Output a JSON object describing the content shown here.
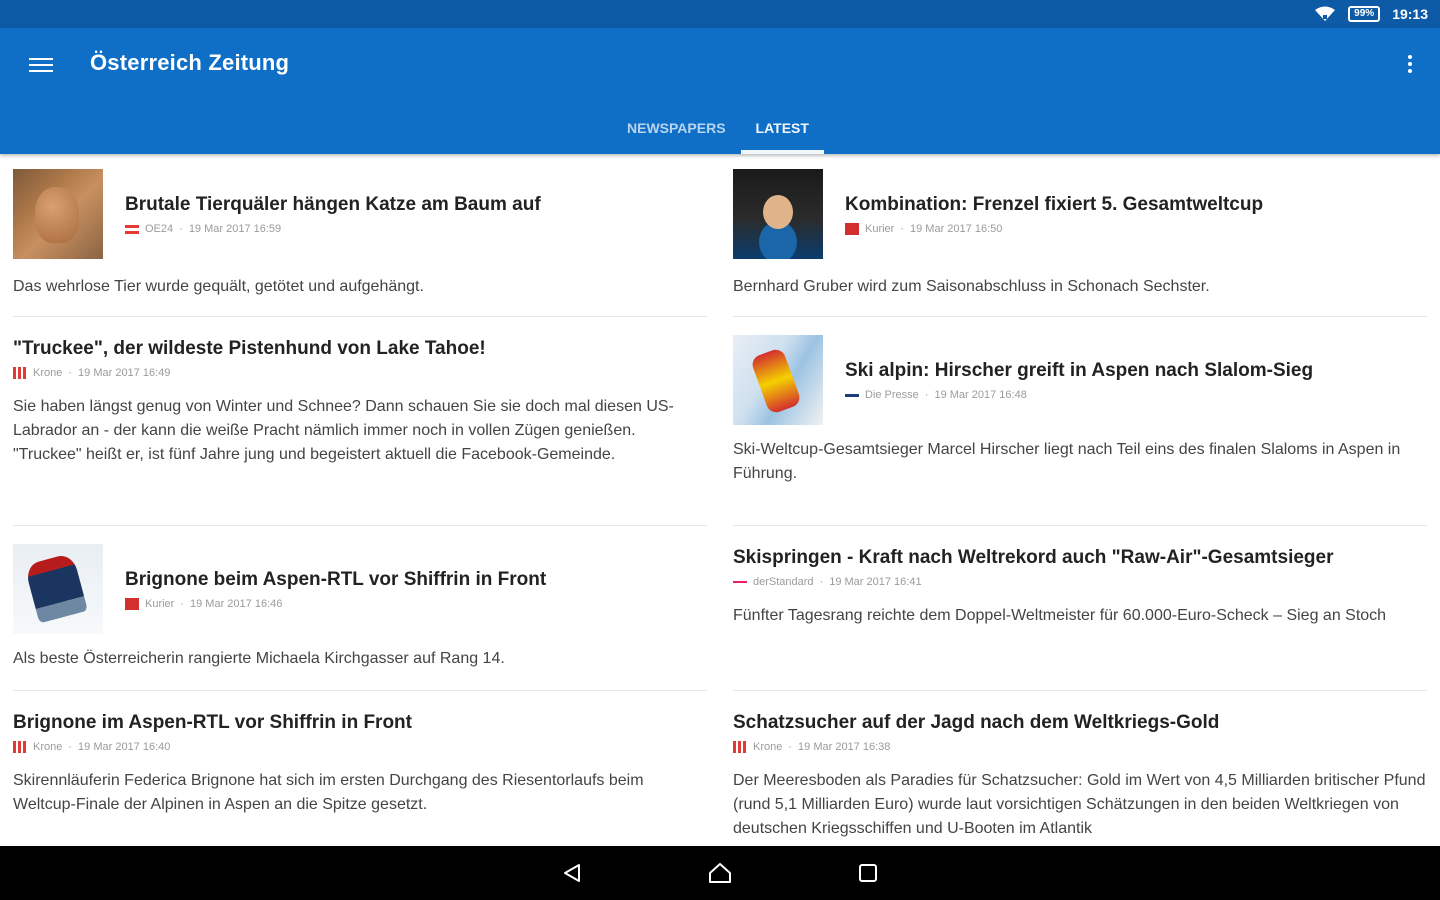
{
  "status_bar": {
    "battery": "99%",
    "time": "19:13"
  },
  "app_bar": {
    "title": "Österreich Zeitung"
  },
  "tabs": [
    {
      "label": "NEWSPAPERS",
      "active": false
    },
    {
      "label": "LATEST",
      "active": true
    }
  ],
  "articles_left": [
    {
      "title": "Brutale Tierquäler hängen Katze am Baum auf",
      "source": "OE24",
      "date": "19 Mar 2017 16:59",
      "summary": "Das wehrlose Tier wurde gequält, getötet und aufgehängt."
    },
    {
      "title": "\"Truckee\", der wildeste Pistenhund von Lake Tahoe!",
      "source": "Krone",
      "date": "19 Mar 2017 16:49",
      "summary": "Sie haben längst genug von Winter und Schnee? Dann schauen Sie sie doch mal diesen US-Labrador an - der kann die weiße Pracht nämlich immer noch in vollen Zügen genießen. \"Truckee\" heißt er, ist fünf Jahre jung und begeistert aktuell die Facebook-Gemeinde."
    },
    {
      "title": "Brignone beim Aspen-RTL vor Shiffrin in Front",
      "source": "Kurier",
      "date": "19 Mar 2017 16:46",
      "summary": "Als beste Österreicherin rangierte Michaela Kirchgasser auf Rang 14."
    },
    {
      "title": "Brignone im Aspen-RTL vor Shiffrin in Front",
      "source": "Krone",
      "date": "19 Mar 2017 16:40",
      "summary": "Skirennläuferin Federica Brignone hat sich im ersten Durchgang des Riesentorlaufs beim Weltcup-Finale der Alpinen in Aspen an die Spitze gesetzt."
    }
  ],
  "articles_right": [
    {
      "title": "Kombination: Frenzel fixiert 5. Gesamtweltcup",
      "source": "Kurier",
      "date": "19 Mar 2017 16:50",
      "summary": "Bernhard Gruber wird zum Saisonabschluss in Schonach Sechster."
    },
    {
      "title": "Ski alpin: Hirscher greift in Aspen nach Slalom-Sieg",
      "source": "Die Presse",
      "date": "19 Mar 2017 16:48",
      "summary": "Ski-Weltcup-Gesamtsieger Marcel Hirscher liegt nach Teil eins des finalen Slaloms in Aspen in Führung."
    },
    {
      "title": "Skispringen - Kraft nach Weltrekord auch \"Raw-Air\"-Gesamtsieger",
      "source": "derStandard",
      "date": "19 Mar 2017 16:41",
      "summary": "Fünfter Tagesrang reichte dem Doppel-Weltmeister für 60.000-Euro-Scheck – Sieg an Stoch"
    },
    {
      "title": "Schatzsucher auf der Jagd nach dem Weltkriegs-Gold",
      "source": "Krone",
      "date": "19 Mar 2017 16:38",
      "summary": "Der Meeresboden als Paradies für Schatzsucher: Gold im Wert von 4,5 Milliarden britischer Pfund (rund 5,1 Milliarden Euro) wurde laut vorsichtigen Schätzungen in den beiden Weltkriegen von deutschen Kriegsschiffen und U-Booten im Atlantik"
    }
  ],
  "colors": {
    "status_bar": "#0d5aa7",
    "app_bar": "#0f6fc6",
    "nav_bar": "#000000"
  },
  "icons": {
    "menu": "menu-icon",
    "more": "more-vert-icon",
    "back": "back-icon",
    "home": "home-icon",
    "recents": "recents-icon",
    "wifi": "wifi-icon",
    "battery": "battery-icon"
  }
}
